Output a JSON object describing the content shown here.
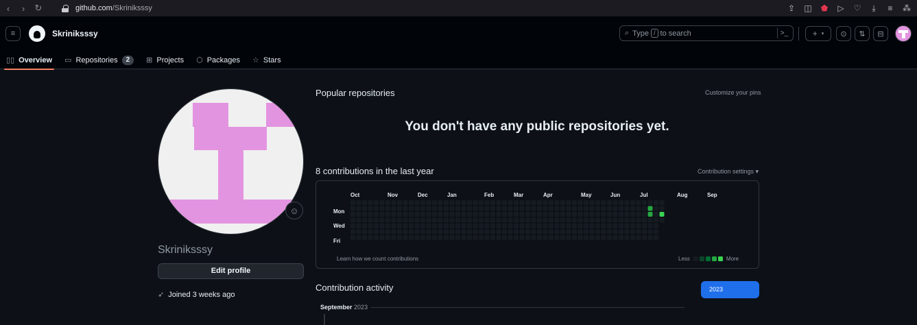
{
  "browser": {
    "url_host": "github.com",
    "url_path": "/Skriniksssy"
  },
  "header": {
    "username": "Skriniksssy",
    "search": {
      "prefix": "Type",
      "key": "/",
      "suffix": "to search"
    }
  },
  "tabs": [
    {
      "label": "Overview",
      "icon": "book-icon",
      "active": true
    },
    {
      "label": "Repositories",
      "icon": "repo-icon",
      "count": "2"
    },
    {
      "label": "Projects",
      "icon": "table-icon"
    },
    {
      "label": "Packages",
      "icon": "package-icon"
    },
    {
      "label": "Stars",
      "icon": "star-icon"
    }
  ],
  "profile": {
    "name": "Skriniksssy",
    "edit_button": "Edit profile",
    "joined": "Joined 3 weeks ago",
    "avatar_color": "#e394e0"
  },
  "popular": {
    "title": "Popular repositories",
    "customize": "Customize your pins",
    "empty_message": "You don't have any public repositories yet."
  },
  "contributions": {
    "title": "8 contributions in the last year",
    "settings": "Contribution settings ▾",
    "months": [
      "Oct",
      "Nov",
      "Dec",
      "Jan",
      "Feb",
      "Mar",
      "Apr",
      "May",
      "Jun",
      "Jul",
      "Aug",
      "Sep"
    ],
    "day_labels": [
      "Mon",
      "Wed",
      "Fri"
    ],
    "learn": "Learn how we count contributions",
    "less": "Less",
    "more": "More",
    "active_cells": [
      {
        "week": 51,
        "day": 1,
        "level": 3
      },
      {
        "week": 51,
        "day": 2,
        "level": 3
      },
      {
        "week": 53,
        "day": 2,
        "level": 4
      }
    ],
    "colors": [
      "#161b22",
      "#0e4429",
      "#006d32",
      "#26a641",
      "#39d353"
    ]
  },
  "activity": {
    "title": "Contribution activity",
    "year": "2023",
    "month": "September",
    "month_year": "2023"
  }
}
